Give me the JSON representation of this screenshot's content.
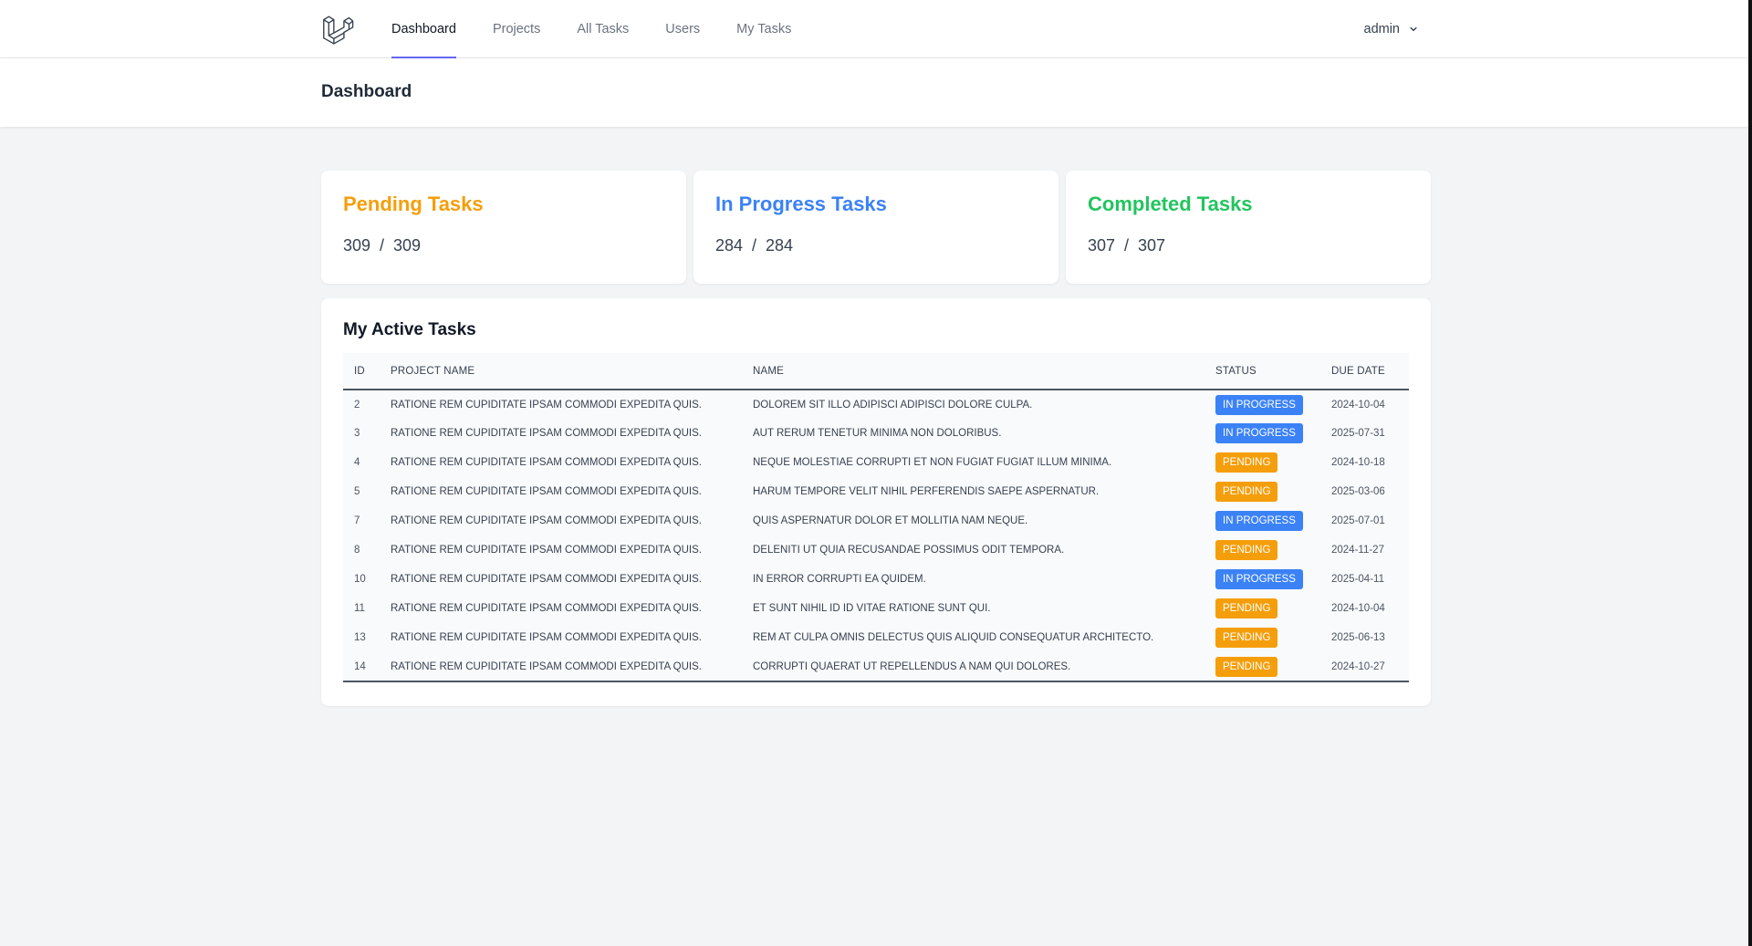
{
  "nav": {
    "links": [
      {
        "label": "Dashboard",
        "active": true
      },
      {
        "label": "Projects",
        "active": false
      },
      {
        "label": "All Tasks",
        "active": false
      },
      {
        "label": "Users",
        "active": false
      },
      {
        "label": "My Tasks",
        "active": false
      }
    ],
    "user": "admin"
  },
  "header": {
    "title": "Dashboard"
  },
  "stats": [
    {
      "title": "Pending Tasks",
      "value": "309  /  309",
      "color": "#f59e0b"
    },
    {
      "title": "In Progress Tasks",
      "value": "284  /  284",
      "color": "#3b82f6"
    },
    {
      "title": "Completed Tasks",
      "value": "307  /  307",
      "color": "#22c55e"
    }
  ],
  "active_tasks": {
    "title": "My Active Tasks",
    "columns": [
      "ID",
      "PROJECT NAME",
      "NAME",
      "STATUS",
      "DUE DATE"
    ],
    "status_colors": {
      "In Progress": "#3b82f6",
      "Pending": "#f59e0b"
    },
    "rows": [
      {
        "id": "2",
        "project": "Ratione rem cupiditate ipsam commodi expedita quis.",
        "name": "Dolorem sit illo adipisci adipisci dolore culpa.",
        "status": "In Progress",
        "due": "2024-10-04"
      },
      {
        "id": "3",
        "project": "Ratione rem cupiditate ipsam commodi expedita quis.",
        "name": "Aut rerum tenetur minima non doloribus.",
        "status": "In Progress",
        "due": "2025-07-31"
      },
      {
        "id": "4",
        "project": "Ratione rem cupiditate ipsam commodi expedita quis.",
        "name": "Neque molestiae corrupti et non fugiat fugiat illum minima.",
        "status": "Pending",
        "due": "2024-10-18"
      },
      {
        "id": "5",
        "project": "Ratione rem cupiditate ipsam commodi expedita quis.",
        "name": "Harum tempore velit nihil perferendis saepe aspernatur.",
        "status": "Pending",
        "due": "2025-03-06"
      },
      {
        "id": "7",
        "project": "Ratione rem cupiditate ipsam commodi expedita quis.",
        "name": "Quis aspernatur dolor et mollitia nam neque.",
        "status": "In Progress",
        "due": "2025-07-01"
      },
      {
        "id": "8",
        "project": "Ratione rem cupiditate ipsam commodi expedita quis.",
        "name": "Deleniti ut quia recusandae possimus odit tempora.",
        "status": "Pending",
        "due": "2024-11-27"
      },
      {
        "id": "10",
        "project": "Ratione rem cupiditate ipsam commodi expedita quis.",
        "name": "In error corrupti ea quidem.",
        "status": "In Progress",
        "due": "2025-04-11"
      },
      {
        "id": "11",
        "project": "Ratione rem cupiditate ipsam commodi expedita quis.",
        "name": "Et sunt nihil id id vitae ratione sunt qui.",
        "status": "Pending",
        "due": "2024-10-04"
      },
      {
        "id": "13",
        "project": "Ratione rem cupiditate ipsam commodi expedita quis.",
        "name": "Rem at culpa omnis delectus quis aliquid consequatur architecto.",
        "status": "Pending",
        "due": "2025-06-13"
      },
      {
        "id": "14",
        "project": "Ratione rem cupiditate ipsam commodi expedita quis.",
        "name": "Corrupti quaerat ut repellendus a nam qui dolores.",
        "status": "Pending",
        "due": "2024-10-27"
      }
    ]
  }
}
